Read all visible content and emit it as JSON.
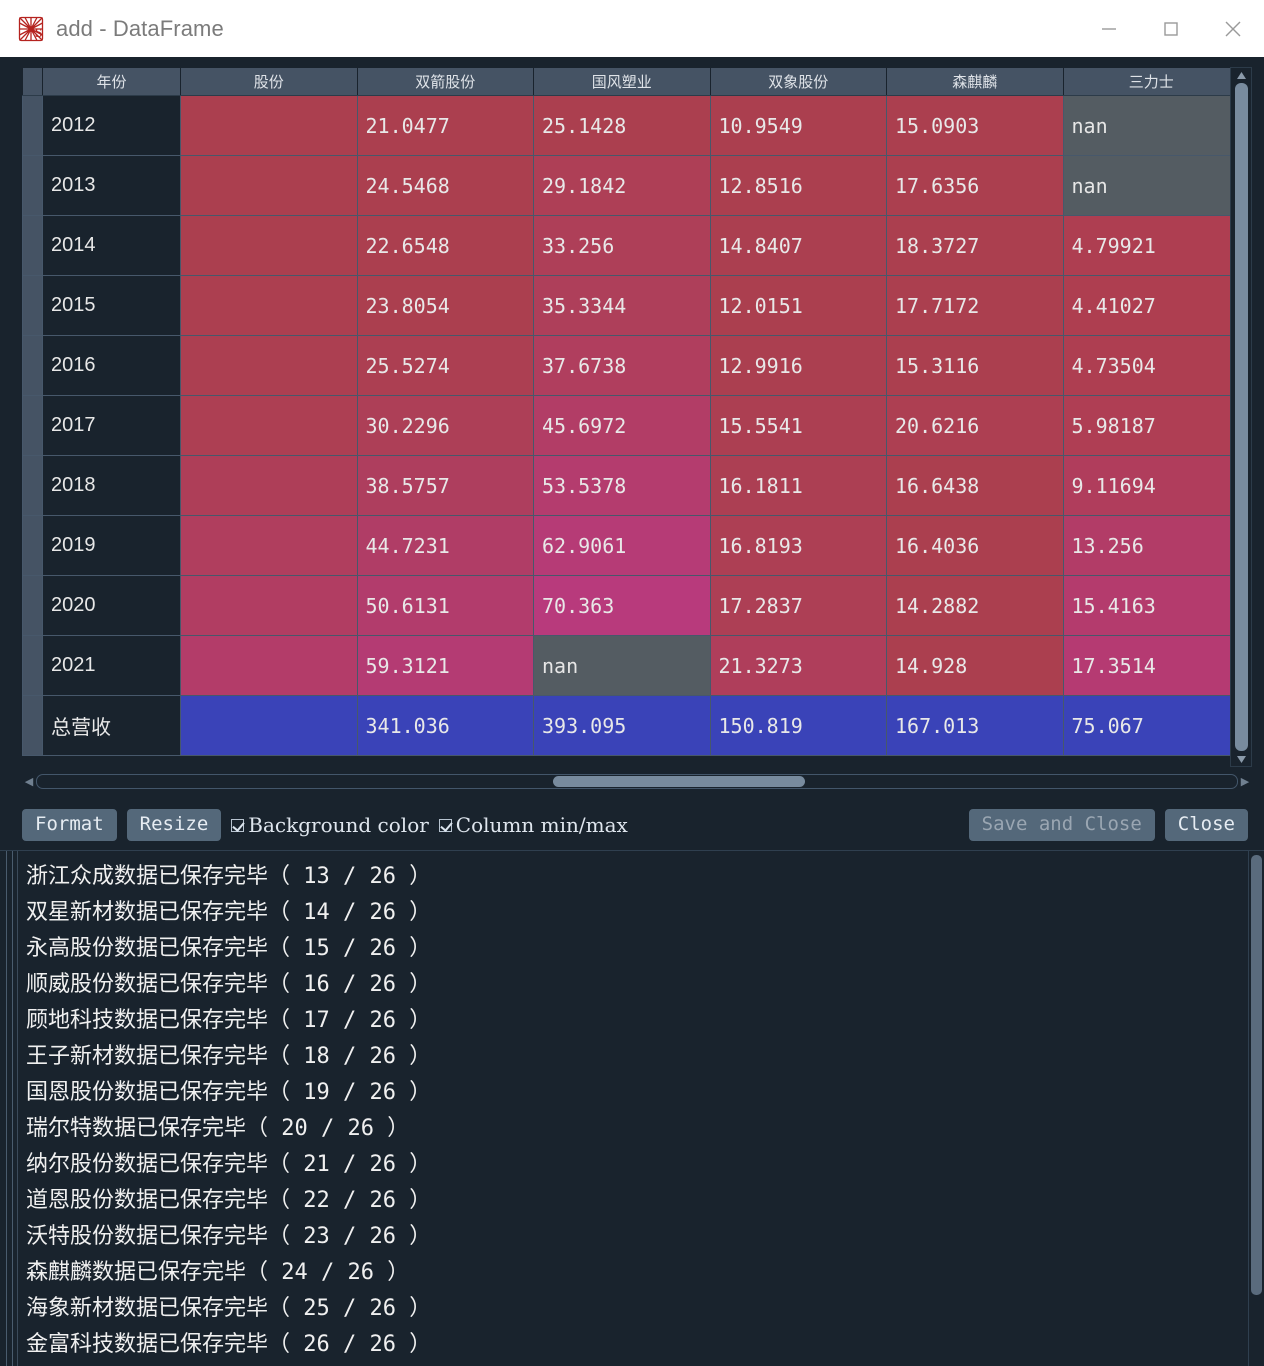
{
  "window": {
    "title": "add - DataFrame",
    "icon": "spyder-logo-icon",
    "minimize_label": "—",
    "maximize_label": "☐",
    "close_label": "✕"
  },
  "table": {
    "headers": [
      "",
      "年份",
      "股份",
      "双箭股份",
      "国风塑业",
      "双象股份",
      "森麒麟",
      "三力士"
    ],
    "rows": [
      {
        "index": "2012",
        "values": [
          "",
          "21.0477",
          "25.1428",
          "10.9549",
          "15.0903",
          "nan"
        ]
      },
      {
        "index": "2013",
        "values": [
          "",
          "24.5468",
          "29.1842",
          "12.8516",
          "17.6356",
          "nan"
        ]
      },
      {
        "index": "2014",
        "values": [
          "",
          "22.6548",
          "33.256",
          "14.8407",
          "18.3727",
          "4.79921"
        ]
      },
      {
        "index": "2015",
        "values": [
          "",
          "23.8054",
          "35.3344",
          "12.0151",
          "17.7172",
          "4.41027"
        ]
      },
      {
        "index": "2016",
        "values": [
          "",
          "25.5274",
          "37.6738",
          "12.9916",
          "15.3116",
          "4.73504"
        ]
      },
      {
        "index": "2017",
        "values": [
          "",
          "30.2296",
          "45.6972",
          "15.5541",
          "20.6216",
          "5.98187"
        ]
      },
      {
        "index": "2018",
        "values": [
          "",
          "38.5757",
          "53.5378",
          "16.1811",
          "16.6438",
          "9.11694"
        ]
      },
      {
        "index": "2019",
        "values": [
          "",
          "44.7231",
          "62.9061",
          "16.8193",
          "16.4036",
          "13.256"
        ]
      },
      {
        "index": "2020",
        "values": [
          "",
          "50.6131",
          "70.363",
          "17.2837",
          "14.2882",
          "15.4163"
        ]
      },
      {
        "index": "2021",
        "values": [
          "",
          "59.3121",
          "nan",
          "21.3273",
          "14.928",
          "17.3514"
        ]
      },
      {
        "index": "总营收",
        "values": [
          "",
          "341.036",
          "393.095",
          "150.819",
          "167.013",
          "75.067"
        ]
      }
    ],
    "cell_colors": [
      [
        "#ab3f4f",
        "#ab3f4f",
        "#ab3f4f",
        "#ab3f4f",
        "#ab3f4f",
        "#545c62"
      ],
      [
        "#ab3f4f",
        "#ab3f4f",
        "#ae3f56",
        "#ab3f4f",
        "#ab3f4f",
        "#545c62"
      ],
      [
        "#ab3f4f",
        "#ab3f4f",
        "#ae3f58",
        "#ab3f50",
        "#ab3f4f",
        "#ae3e51"
      ],
      [
        "#ac3f50",
        "#ab3f4f",
        "#ae3f5a",
        "#ab3f4f",
        "#ab3f4f",
        "#ae3e50"
      ],
      [
        "#ac3f51",
        "#ac3f52",
        "#b03e5e",
        "#ab3f50",
        "#ab3f4f",
        "#ae3e51"
      ],
      [
        "#ad3f53",
        "#ad3f57",
        "#b23d66",
        "#ac3f52",
        "#ad3f52",
        "#af3e54"
      ],
      [
        "#ae3e58",
        "#ae3e5e",
        "#b43c6e",
        "#ac3f53",
        "#ab3f4f",
        "#b03d5c"
      ],
      [
        "#b03e5e",
        "#b03d66",
        "#b63b76",
        "#ad3f54",
        "#ab3f4f",
        "#b23c67"
      ],
      [
        "#b13d62",
        "#b23c6c",
        "#b83a7c",
        "#ad3f55",
        "#ab3f4f",
        "#b43b6d"
      ],
      [
        "#b33c69",
        "#b43b73",
        "#545c62",
        "#af3e5b",
        "#ab3f4f",
        "#b53a72"
      ],
      [
        "#3a43b8",
        "#3a43b8",
        "#3a43b8",
        "#3a43b8",
        "#3a43b8",
        "#3a43b8"
      ]
    ],
    "nan_color": "#545c62",
    "total_color": "#3a43b8"
  },
  "toolbar": {
    "format_label": "Format",
    "resize_label": "Resize",
    "background_color_label": "Background color",
    "column_minmax_label": "Column min/max",
    "save_and_close_label": "Save and Close",
    "close_label": "Close",
    "background_color_checked": true,
    "column_minmax_checked": true
  },
  "console": {
    "lines": [
      "浙江众成数据已保存完毕（ 13 / 26 ）",
      "双星新材数据已保存完毕（ 14 / 26 ）",
      "永高股份数据已保存完毕（ 15 / 26 ）",
      "顺威股份数据已保存完毕（ 16 / 26 ）",
      "顾地科技数据已保存完毕（ 17 / 26 ）",
      "王子新材数据已保存完毕（ 18 / 26 ）",
      "国恩股份数据已保存完毕（ 19 / 26 ）",
      "瑞尔特数据已保存完毕（ 20 / 26 ）",
      "纳尔股份数据已保存完毕（ 21 / 26 ）",
      "道恩股份数据已保存完毕（ 22 / 26 ）",
      "沃特股份数据已保存完毕（ 23 / 26 ）",
      "森麒麟数据已保存完毕（ 24 / 26 ）",
      "海象新材数据已保存完毕（ 25 / 26 ）",
      "金富科技数据已保存完毕（ 26 / 26 ）"
    ]
  }
}
